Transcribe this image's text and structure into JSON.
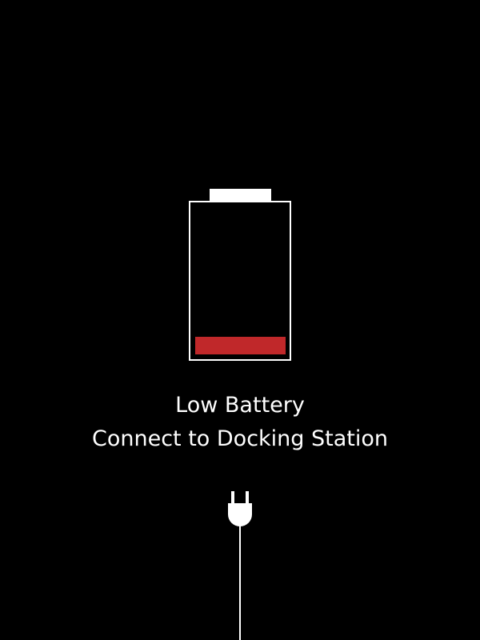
{
  "battery": {
    "charge_fraction": 0.12,
    "level_color": "#c0282a",
    "outline_color": "#ffffff",
    "state": "low"
  },
  "message": {
    "line1": "Low Battery",
    "line2": "Connect to Docking Station"
  },
  "icons": {
    "battery": "battery-low-icon",
    "plug": "power-plug-icon"
  },
  "colors": {
    "background": "#000000",
    "foreground": "#ffffff"
  }
}
